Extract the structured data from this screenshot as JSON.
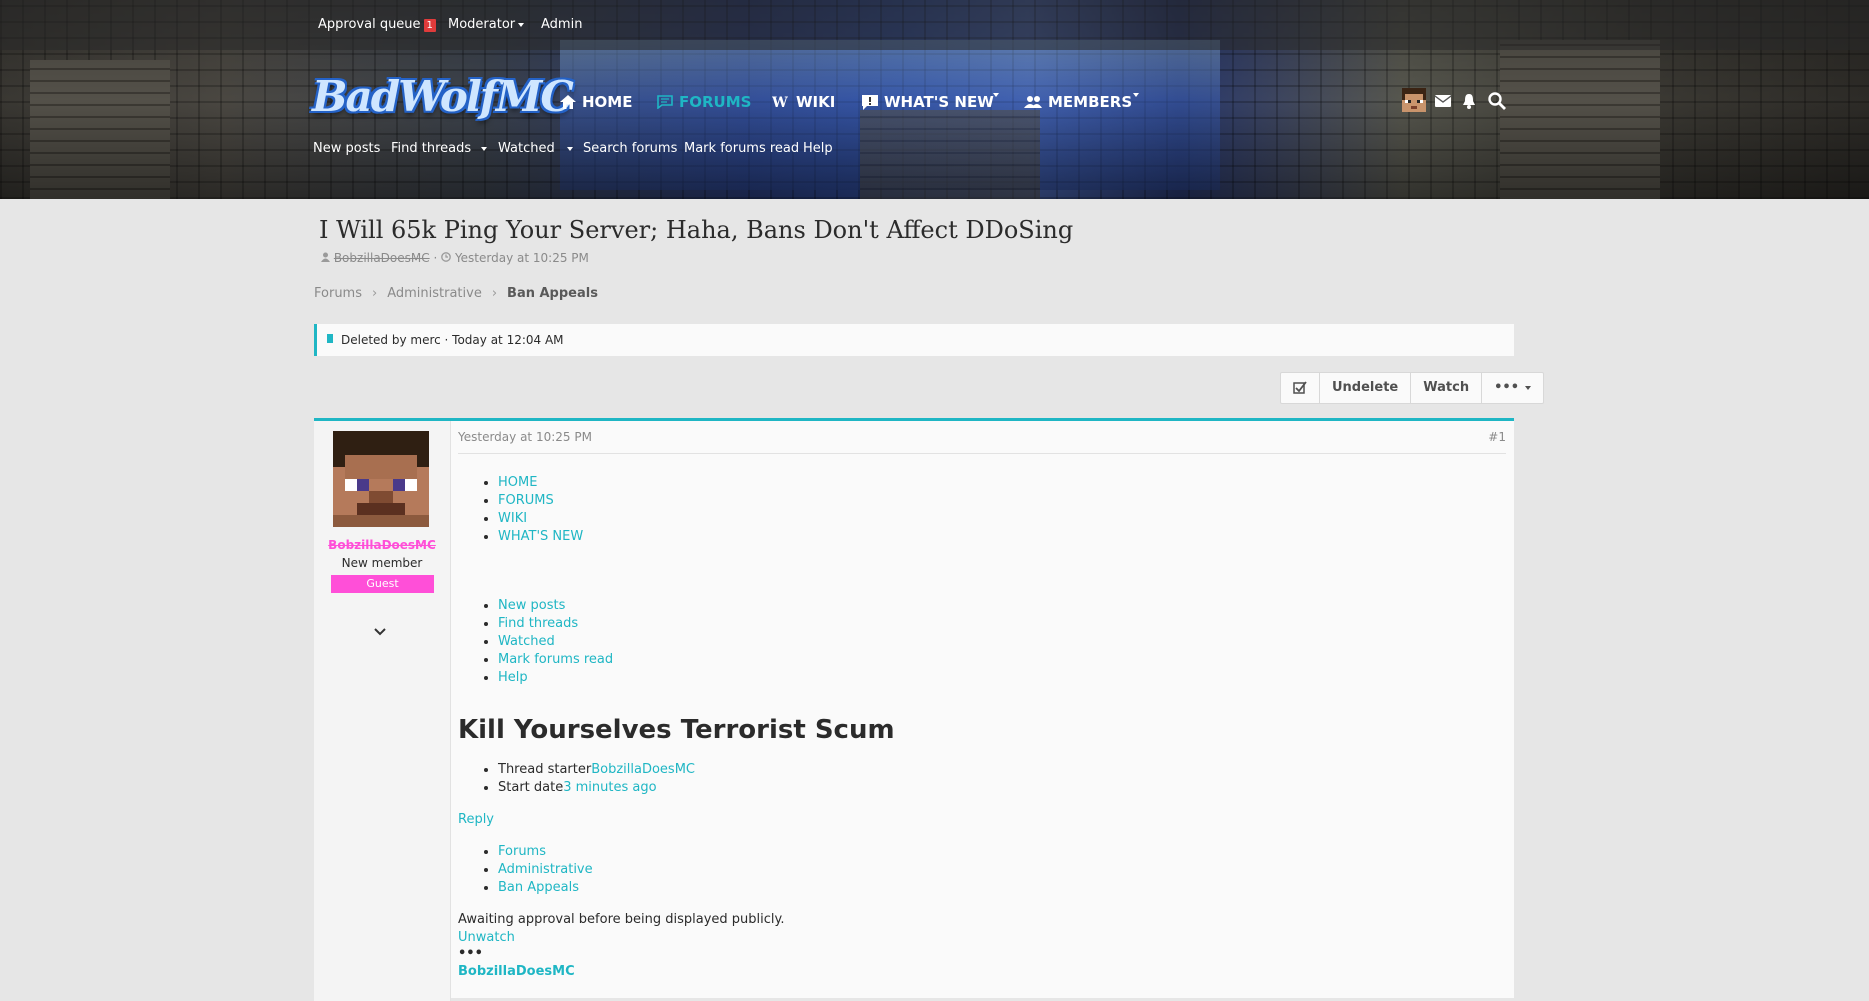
{
  "topbar": {
    "approval_queue": "Approval queue",
    "approval_count": "1",
    "moderator": "Moderator",
    "admin": "Admin"
  },
  "logo": {
    "text": "BadWolfMC"
  },
  "nav": {
    "home": "HOME",
    "forums": "FORUMS",
    "wiki": "WIKI",
    "whats_new": "WHAT'S NEW",
    "members": "MEMBERS"
  },
  "subnav": {
    "new_posts": "New posts",
    "find_threads": "Find threads",
    "watched": "Watched",
    "search_forums": "Search forums",
    "mark_forums_read": "Mark forums read",
    "help": "Help"
  },
  "thread": {
    "title": "I Will 65k Ping Your Server; Haha, Bans Don't Affect DDoSing",
    "author": "BobzillaDoesMC",
    "date": "Yesterday at 10:25 PM"
  },
  "breadcrumb": [
    "Forums",
    "Administrative",
    "Ban Appeals"
  ],
  "notice": {
    "text": "Deleted by merc · Today at 12:04 AM"
  },
  "actions": {
    "undelete": "Undelete",
    "watch": "Watch",
    "more": "•••"
  },
  "post": {
    "user": {
      "name": "BobzillaDoesMC",
      "title": "New member",
      "banner": "Guest"
    },
    "date": "Yesterday at 10:25 PM",
    "number": "#1",
    "nav_list": [
      "HOME",
      "FORUMS",
      "WIKI",
      "WHAT'S NEW"
    ],
    "subnav_list": [
      "New posts",
      "Find threads",
      "Watched",
      "Mark forums read",
      "Help"
    ],
    "heading": "Kill Yourselves Terrorist Scum",
    "starter_label": "Thread starter",
    "starter_value": "BobzillaDoesMC",
    "start_date_label": "Start date",
    "start_date_value": "3 minutes ago",
    "reply": "Reply",
    "crumbs_list": [
      "Forums",
      "Administrative",
      "Ban Appeals"
    ],
    "awaiting": "Awaiting approval before being displayed publicly.",
    "unwatch": "Unwatch",
    "dots": "•••",
    "author_repeat": "BobzillaDoesMC"
  },
  "colors": {
    "accent": "#1fb6c4",
    "guest_banner": "#ff4fd8",
    "badge": "#e03b3b"
  }
}
